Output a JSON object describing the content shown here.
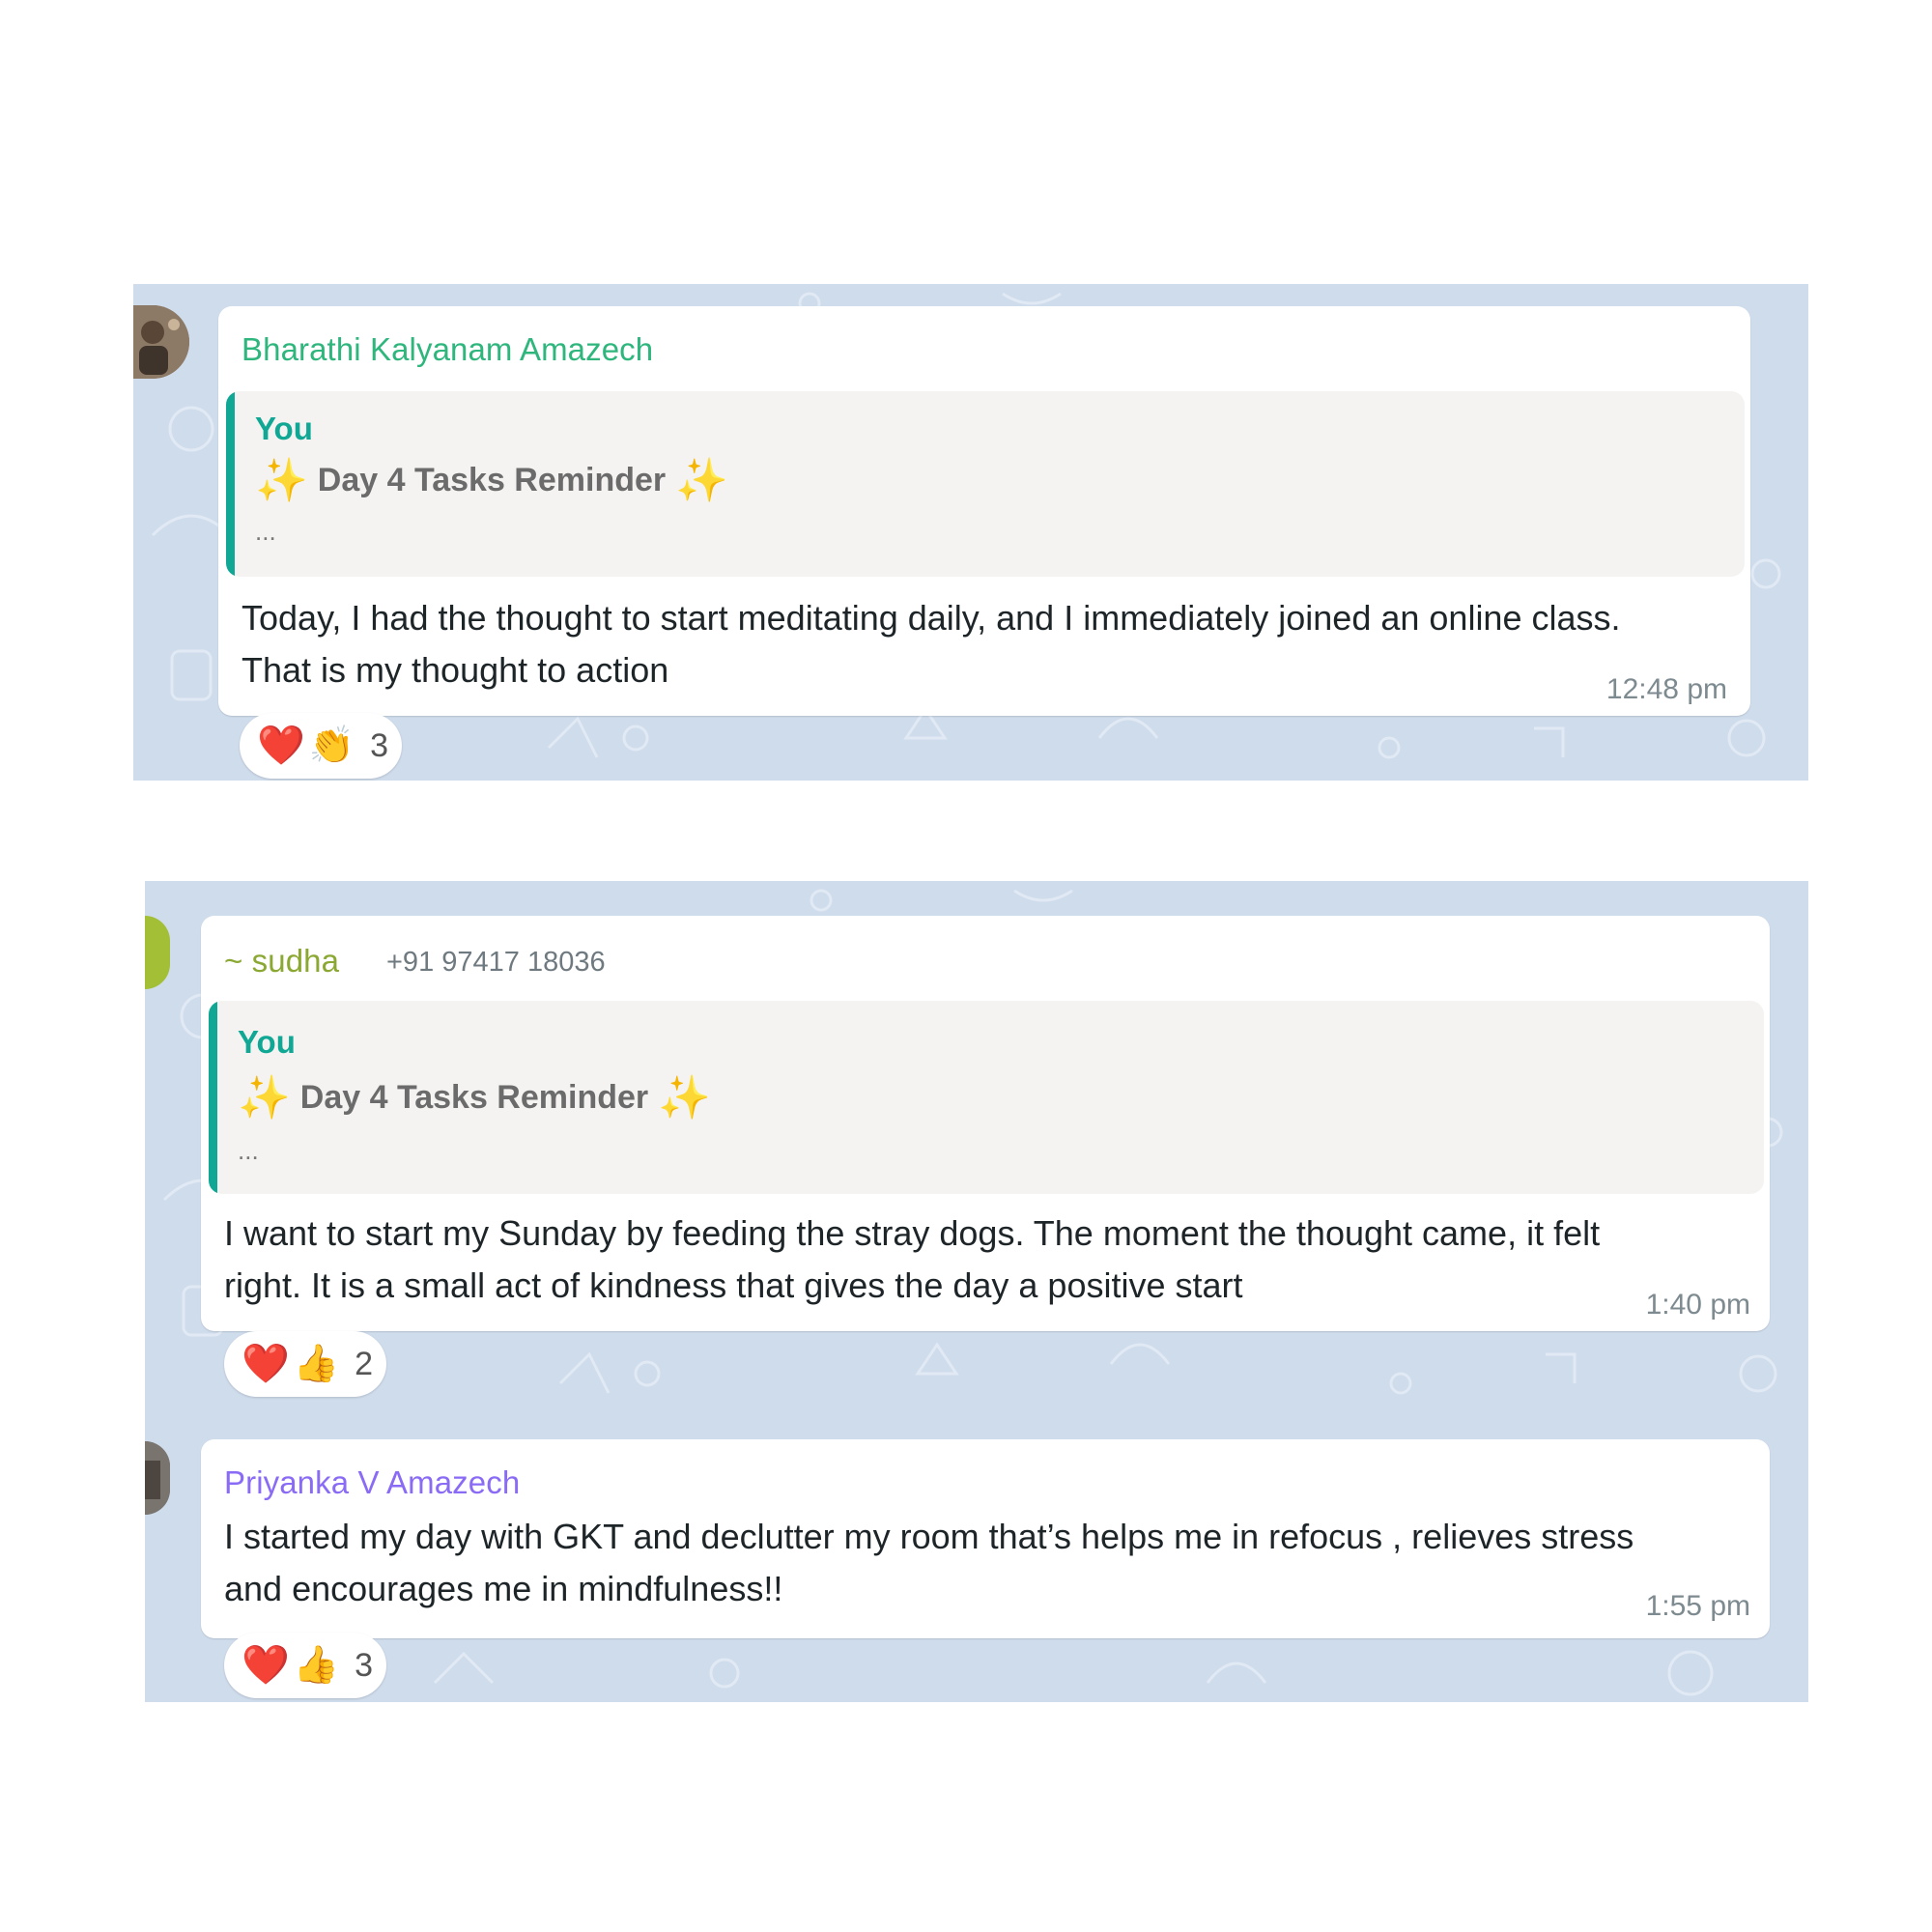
{
  "colors": {
    "chat_background": "#cfdcec",
    "quote_accent": "#10a895",
    "sender_green": "#2eb67d",
    "sender_olive": "#8aa832",
    "sender_purple": "#8a6bf5"
  },
  "messages": [
    {
      "sender": "Bharathi Kalyanam Amazech",
      "quote": {
        "author": "You",
        "title": "Day 4 Tasks Reminder",
        "sparkle_icon": "sparkles-icon",
        "ellipsis": "..."
      },
      "text_lines": [
        "Today, I had the thought to start meditating daily, and I immediately joined an online class.",
        "That is my thought to action"
      ],
      "time": "12:48 pm",
      "reactions": {
        "emojis": [
          "❤️",
          "👏"
        ],
        "count": "3"
      }
    },
    {
      "sender": "~ sudha",
      "phone": "+91 97417 18036",
      "quote": {
        "author": "You",
        "title": "Day 4 Tasks Reminder",
        "sparkle_icon": "sparkles-icon",
        "ellipsis": "..."
      },
      "text_lines": [
        "I want to start my Sunday by feeding the stray dogs. The moment the thought came, it felt",
        "right. It is a small act of kindness that gives the day a positive start"
      ],
      "time": "1:40 pm",
      "reactions": {
        "emojis": [
          "❤️",
          "👍"
        ],
        "count": "2"
      }
    },
    {
      "sender": "Priyanka V Amazech",
      "text_lines": [
        "I started my day with GKT and declutter my room that’s helps me in refocus , relieves stress",
        "and encourages me in mindfulness!!"
      ],
      "time": "1:55 pm",
      "reactions": {
        "emojis": [
          "❤️",
          "👍"
        ],
        "count": "3"
      }
    }
  ]
}
